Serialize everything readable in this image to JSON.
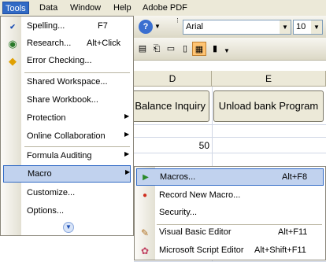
{
  "menubar": {
    "items": [
      {
        "label": "Tools"
      },
      {
        "label": "Data"
      },
      {
        "label": "Window"
      },
      {
        "label": "Help"
      },
      {
        "label": "Adobe PDF"
      }
    ]
  },
  "toolbar": {
    "font_name": "Arial",
    "font_size": "10"
  },
  "sheet": {
    "columns": [
      "D",
      "E"
    ],
    "buttons": [
      "Balance Inquiry",
      "Unload bank Program"
    ],
    "cell_value": "50"
  },
  "tools_menu": {
    "items": [
      {
        "label": "Spelling...",
        "shortcut": "F7"
      },
      {
        "label": "Research...",
        "shortcut": "Alt+Click"
      },
      {
        "label": "Error Checking..."
      },
      {
        "label": "Shared Workspace..."
      },
      {
        "label": "Share Workbook..."
      },
      {
        "label": "Protection"
      },
      {
        "label": "Online Collaboration"
      },
      {
        "label": "Formula Auditing"
      },
      {
        "label": "Macro"
      },
      {
        "label": "Customize..."
      },
      {
        "label": "Options..."
      }
    ]
  },
  "macro_submenu": {
    "items": [
      {
        "label": "Macros...",
        "shortcut": "Alt+F8"
      },
      {
        "label": "Record New Macro..."
      },
      {
        "label": "Security..."
      },
      {
        "label": "Visual Basic Editor",
        "shortcut": "Alt+F11"
      },
      {
        "label": "Microsoft Script Editor",
        "shortcut": "Alt+Shift+F11"
      }
    ]
  },
  "colors": {
    "menu_highlight": "#C1D2EE",
    "menu_highlight_border": "#316AC5",
    "menubar_bg": "#ECE9D8"
  }
}
